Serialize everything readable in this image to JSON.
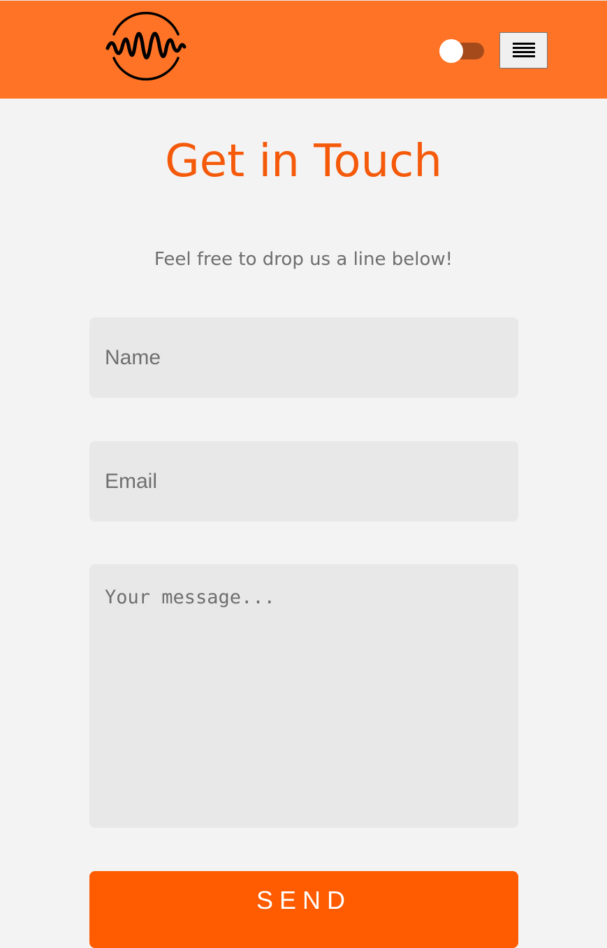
{
  "header": {
    "logo_icon": "sound-wave-circle-logo",
    "theme_toggle": {
      "state": "off",
      "icon": "toggle-switch"
    },
    "menu_icon": "hamburger-menu-icon"
  },
  "main": {
    "title": "Get in Touch",
    "subtitle": "Feel free to drop us a line below!"
  },
  "form": {
    "name_placeholder": "Name",
    "email_placeholder": "Email",
    "message_placeholder": "Your message...",
    "send_label": "SEND"
  },
  "colors": {
    "header_bg": "#ff7326",
    "accent": "#f55a0a",
    "button_bg": "#ff5b00",
    "page_bg": "#f3f3f3",
    "field_bg": "#e8e8e8"
  }
}
